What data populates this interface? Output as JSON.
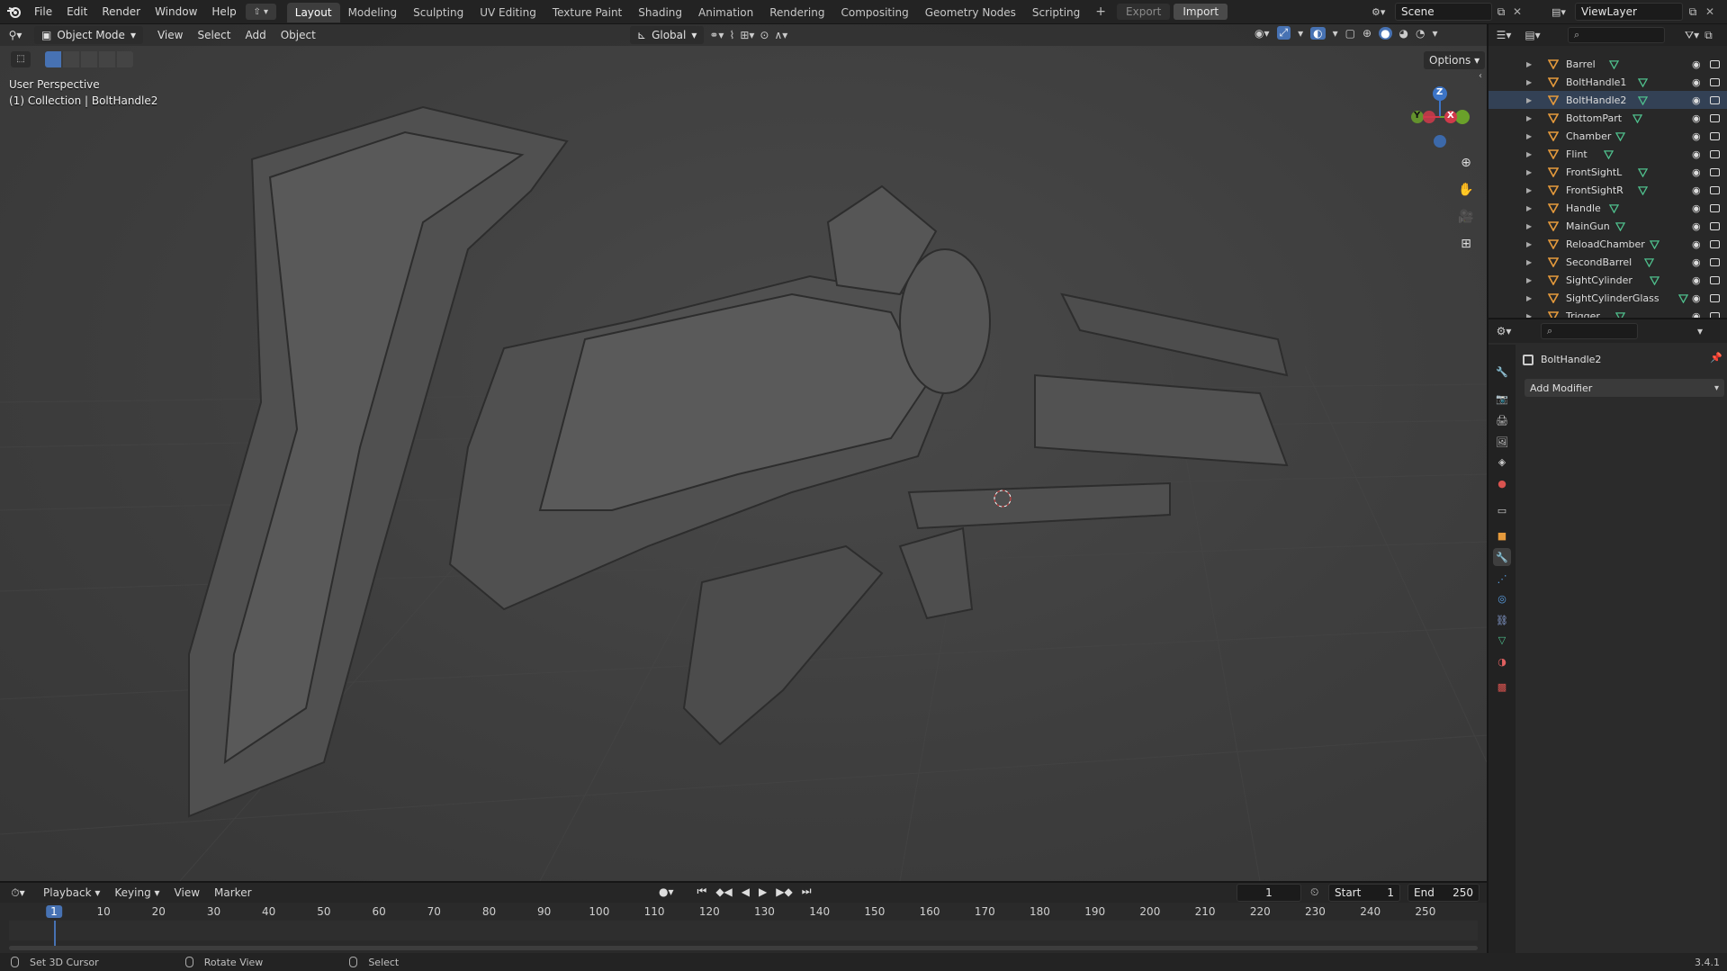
{
  "topbar": {
    "menus": [
      "File",
      "Edit",
      "Render",
      "Window",
      "Help"
    ],
    "workspaces": [
      "Layout",
      "Modeling",
      "Sculpting",
      "UV Editing",
      "Texture Paint",
      "Shading",
      "Animation",
      "Rendering",
      "Compositing",
      "Geometry Nodes",
      "Scripting"
    ],
    "active_workspace": "Layout",
    "export_label": "Export",
    "import_label": "Import",
    "scene_name": "Scene",
    "view_layer": "ViewLayer"
  },
  "viewport": {
    "mode": "Object Mode",
    "menus": [
      "View",
      "Select",
      "Add",
      "Object"
    ],
    "orientation": "Global",
    "options_label": "Options",
    "overlay_line1": "User Perspective",
    "overlay_line2": "(1) Collection | BoltHandle2",
    "gizmo": {
      "x": "X",
      "y": "Y",
      "z": "Z"
    },
    "colors": {
      "x_axis": "#d03a4a",
      "y_axis": "#6aa12a",
      "z_axis": "#3c74c6",
      "accent": "#4772b3"
    }
  },
  "outliner": {
    "items": [
      "Barrel",
      "BoltHandle1",
      "BoltHandle2",
      "BottomPart",
      "Chamber",
      "Flint",
      "FrontSightL",
      "FrontSightR",
      "Handle",
      "MainGun",
      "ReloadChamber",
      "SecondBarrel",
      "SightCylinder",
      "SightCylinderGlass",
      "Trigger"
    ],
    "selected": "BoltHandle2"
  },
  "properties": {
    "object_name": "BoltHandle2",
    "add_modifier_label": "Add Modifier",
    "tab_icons": [
      "tool-icon",
      "render-icon",
      "output-icon",
      "view-layer-icon",
      "scene-icon",
      "world-icon",
      "collection-icon",
      "object-icon",
      "modifier-icon",
      "particles-icon",
      "physics-icon",
      "constraints-icon",
      "data-icon",
      "material-icon",
      "texture-icon"
    ]
  },
  "timeline": {
    "menus": [
      "Playback",
      "Keying",
      "View",
      "Marker"
    ],
    "current_frame": "1",
    "start_label": "Start",
    "start_value": "1",
    "end_label": "End",
    "end_value": "250",
    "ruler_labels": [
      "1",
      "10",
      "20",
      "30",
      "40",
      "50",
      "60",
      "70",
      "80",
      "90",
      "100",
      "110",
      "120",
      "130",
      "140",
      "150",
      "160",
      "170",
      "180",
      "190",
      "200",
      "210",
      "220",
      "230",
      "240",
      "250"
    ]
  },
  "statusbar": {
    "hint1": "Set 3D Cursor",
    "hint2": "Rotate View",
    "hint3": "Select",
    "version": "3.4.1"
  }
}
